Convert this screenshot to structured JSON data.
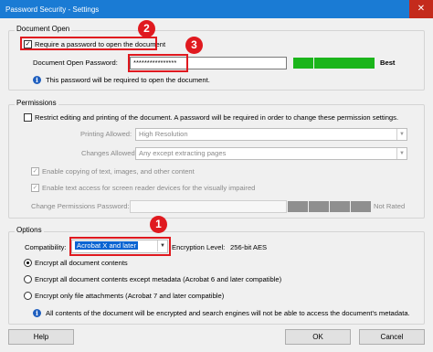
{
  "window": {
    "title": "Password Security - Settings",
    "close_glyph": "✕"
  },
  "document_open": {
    "legend": "Document Open",
    "require_label": "Require a password to open the document",
    "require_checked": true,
    "password_label": "Document Open Password:",
    "password_value": "****************",
    "strength_label": "Best",
    "strength_color": "#1bb51b",
    "info_text": "This password will be required to open the document."
  },
  "permissions": {
    "legend": "Permissions",
    "restrict_label": "Restrict editing and printing of the document. A password will be required in order to change these permission settings.",
    "printing_label": "Printing Allowed:",
    "printing_value": "High Resolution",
    "changes_label": "Changes Allowed:",
    "changes_value": "Any except extracting pages",
    "copy_label": "Enable copying of text, images, and other content",
    "access_label": "Enable text access for screen reader devices for the visually impaired",
    "change_pw_label": "Change Permissions Password:",
    "rating_label": "Not Rated"
  },
  "options": {
    "legend": "Options",
    "compat_label": "Compatibility:",
    "compat_value": "Acrobat X and later",
    "encryption_label": "Encryption  Level:",
    "encryption_value": "256-bit AES",
    "radio_all": "Encrypt all document contents",
    "radio_except": "Encrypt all document contents except metadata (Acrobat 6 and later compatible)",
    "radio_attach": "Encrypt only file attachments (Acrobat 7 and later compatible)",
    "info_text": "All contents of the document will be encrypted and search engines will not be able to access the document's metadata."
  },
  "buttons": {
    "help": "Help",
    "ok": "OK",
    "cancel": "Cancel"
  },
  "annotations": {
    "badge1": "1",
    "badge2": "2",
    "badge3": "3",
    "color": "#e0191f"
  }
}
